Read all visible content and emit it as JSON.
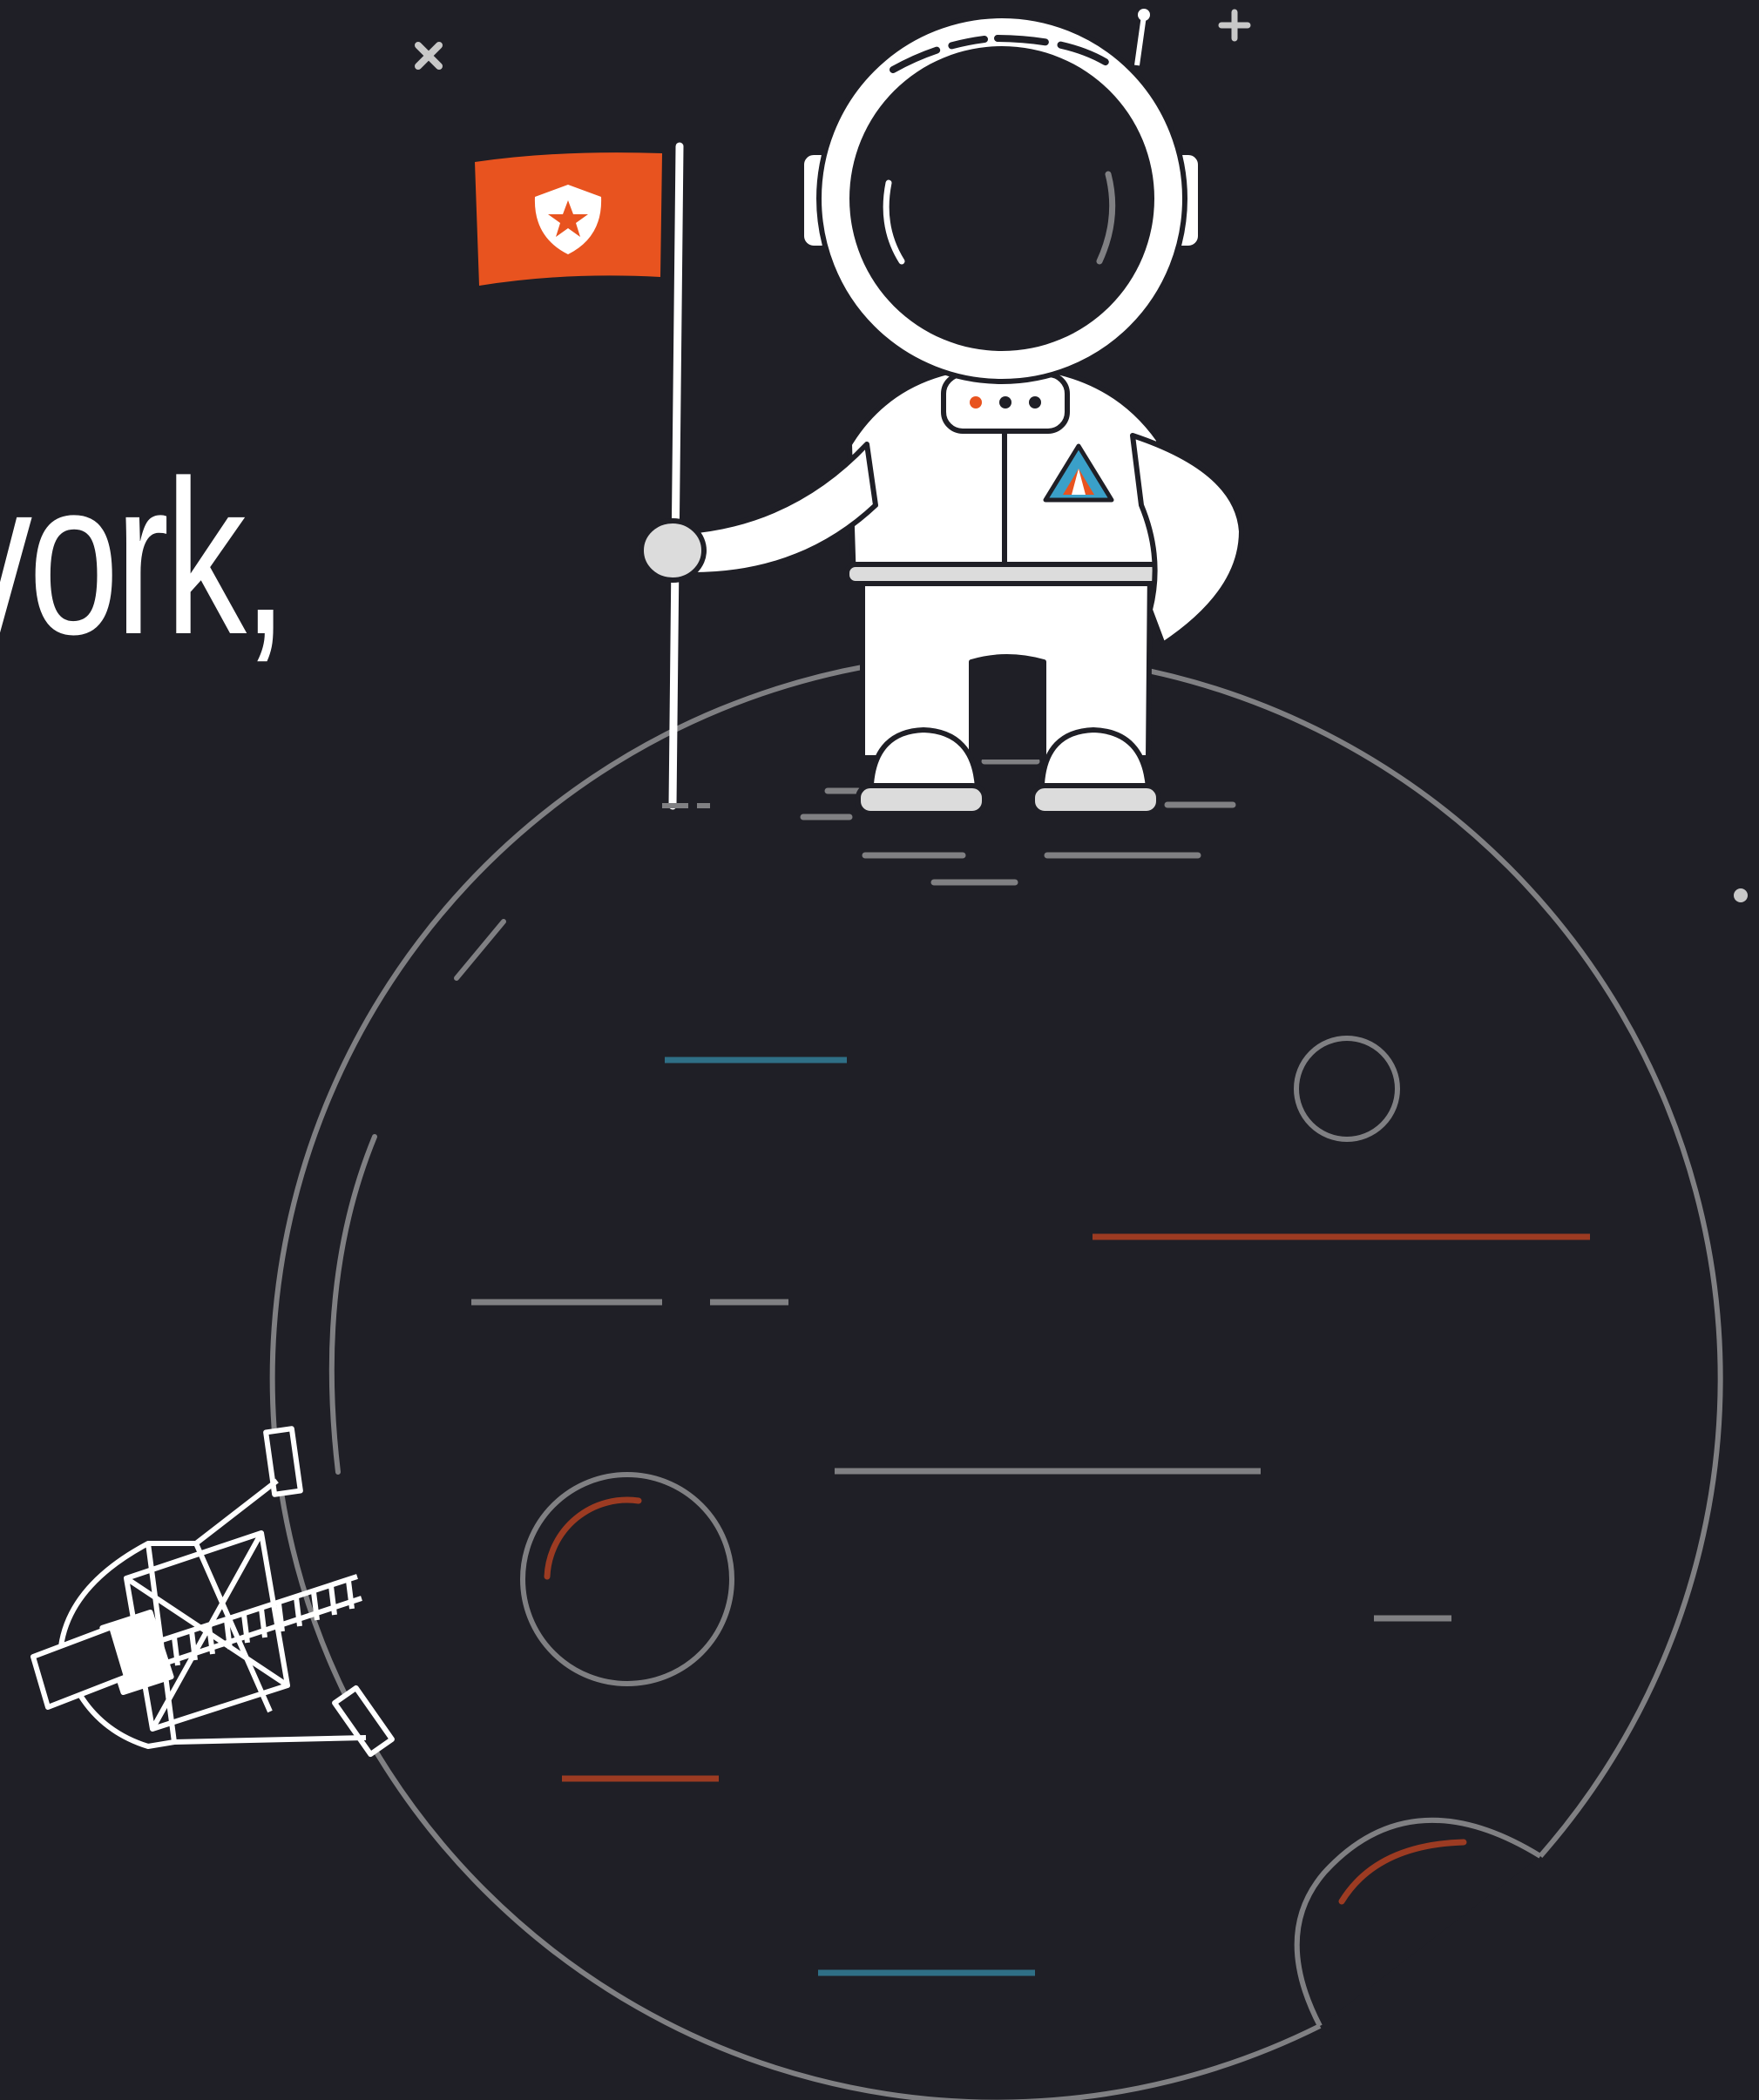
{
  "headline": {
    "text": "vork,",
    "color": "#ffffff"
  },
  "palette": {
    "background": "#1f1f26",
    "outline": "#808083",
    "flag": "#e8531f",
    "suit": "#ffffff",
    "suit_shade": "#dcdcdc",
    "accent_red": "#9c3b22",
    "accent_blue": "#2f6f86",
    "badge_blue": "#3aa0c9",
    "badge_orange": "#e8531f"
  },
  "icons": {
    "flag_emblem": "star-shield-icon",
    "suit_badge": "triangle-badge-icon",
    "satellite": "satellite-icon"
  }
}
